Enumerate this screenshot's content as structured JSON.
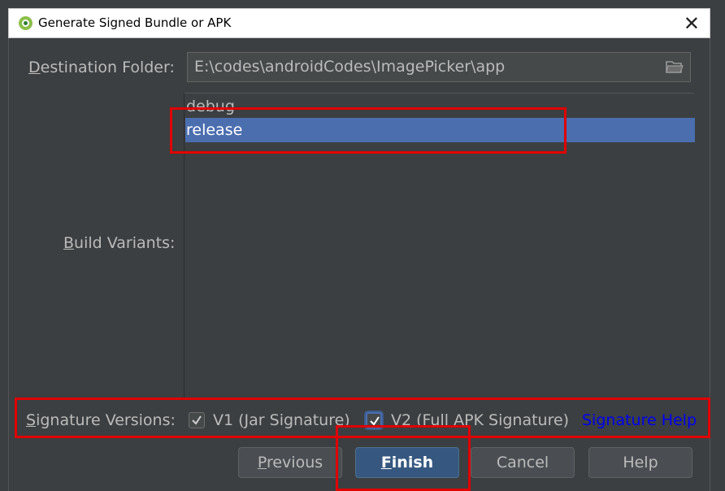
{
  "window": {
    "title": "Generate Signed Bundle or APK",
    "close_glyph": "✕"
  },
  "destination": {
    "label": "Destination Folder:",
    "value": "E:\\codes\\androidCodes\\ImagePicker\\app"
  },
  "build_variants": {
    "label": "Build Variants:",
    "items": [
      {
        "label": "debug",
        "selected": false
      },
      {
        "label": "release",
        "selected": true
      }
    ]
  },
  "signature": {
    "label": "Signature Versions:",
    "v1": {
      "label": "V1 (Jar Signature)",
      "checked": true
    },
    "v2": {
      "label": "V2 (Full APK Signature)",
      "checked": true
    },
    "help_link": "Signature Help"
  },
  "buttons": {
    "previous": "Previous",
    "finish": "Finish",
    "cancel": "Cancel",
    "help": "Help"
  },
  "colors": {
    "background": "#3c3f41",
    "selection": "#4b6eaf",
    "highlight": "#e00000",
    "link": "#0000ee"
  }
}
